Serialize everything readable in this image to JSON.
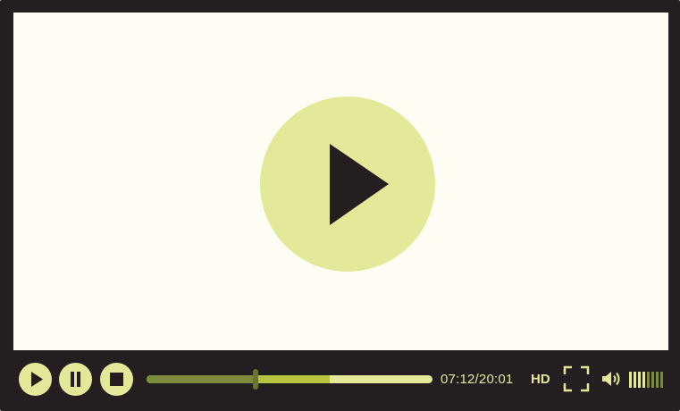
{
  "player": {
    "time_display": "07:12/20:01",
    "quality_label": "HD",
    "progress": {
      "played_fraction": 0.38,
      "buffered_fraction": 0.64
    },
    "volume": {
      "total_bars": 8,
      "active_bars": 4
    },
    "colors": {
      "frame": "#231f20",
      "screen": "#fdfdf4",
      "accent": "#e2ea9a",
      "played": "#7b8a3b",
      "buffered": "#b6c43f",
      "icon": "#231f20"
    },
    "icons": {
      "big_play": "play-icon",
      "play": "play-icon",
      "pause": "pause-icon",
      "stop": "stop-icon",
      "fullscreen": "fullscreen-icon",
      "volume": "speaker-icon"
    }
  }
}
